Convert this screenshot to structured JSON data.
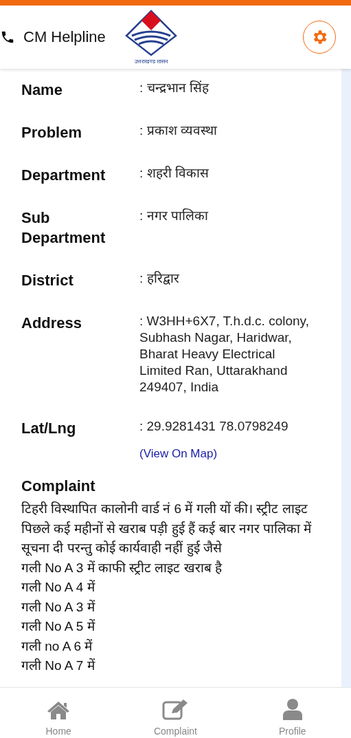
{
  "header": {
    "title": "CM Helpline",
    "logo_caption": "उत्तराखण्ड शासन"
  },
  "details": [
    {
      "label": "Name",
      "value": ": चन्द्रभान सिंह"
    },
    {
      "label": "Problem",
      "value": ": प्रकाश व्यवस्था"
    },
    {
      "label": "Department",
      "value": ": शहरी विकास"
    },
    {
      "label": "Sub Department",
      "value": ": नगर पालिका"
    },
    {
      "label": "District",
      "value": ": हरिद्वार"
    },
    {
      "label": "Address",
      "value": ": W3HH+6X7, T.h.d.c. colony, Subhash Nagar, Haridwar, Bharat Heavy Electrical Limited Ran, Uttarakhand 249407, India"
    },
    {
      "label": "Lat/Lng",
      "value": ": 29.9281431 78.0798249"
    }
  ],
  "map_link": "(View On Map)",
  "complaint": {
    "heading": "Complaint",
    "lines": [
      "टिहरी विस्थापित कालोनी वार्ड नं 6 में गली यों की। स्ट्रीट लाइट पिछले कई महीनों से खराब पड़ी हुई हैं कई बार नगर पालिका में सूचना दी परन्तु कोई कार्यवाही नहीं हुई जैसे",
      "गली No A 3 में काफी स्ट्रीट लाइट खराब है",
      "गली No A 4 में",
      "गली No A 3 में",
      "गली No A 5 में",
      "गली no A 6 में",
      "गली No A 7 में"
    ]
  },
  "nav": [
    {
      "kind": "home",
      "label": "Home"
    },
    {
      "kind": "complaint",
      "label": "Complaint"
    },
    {
      "kind": "profile",
      "label": "Profile"
    }
  ]
}
